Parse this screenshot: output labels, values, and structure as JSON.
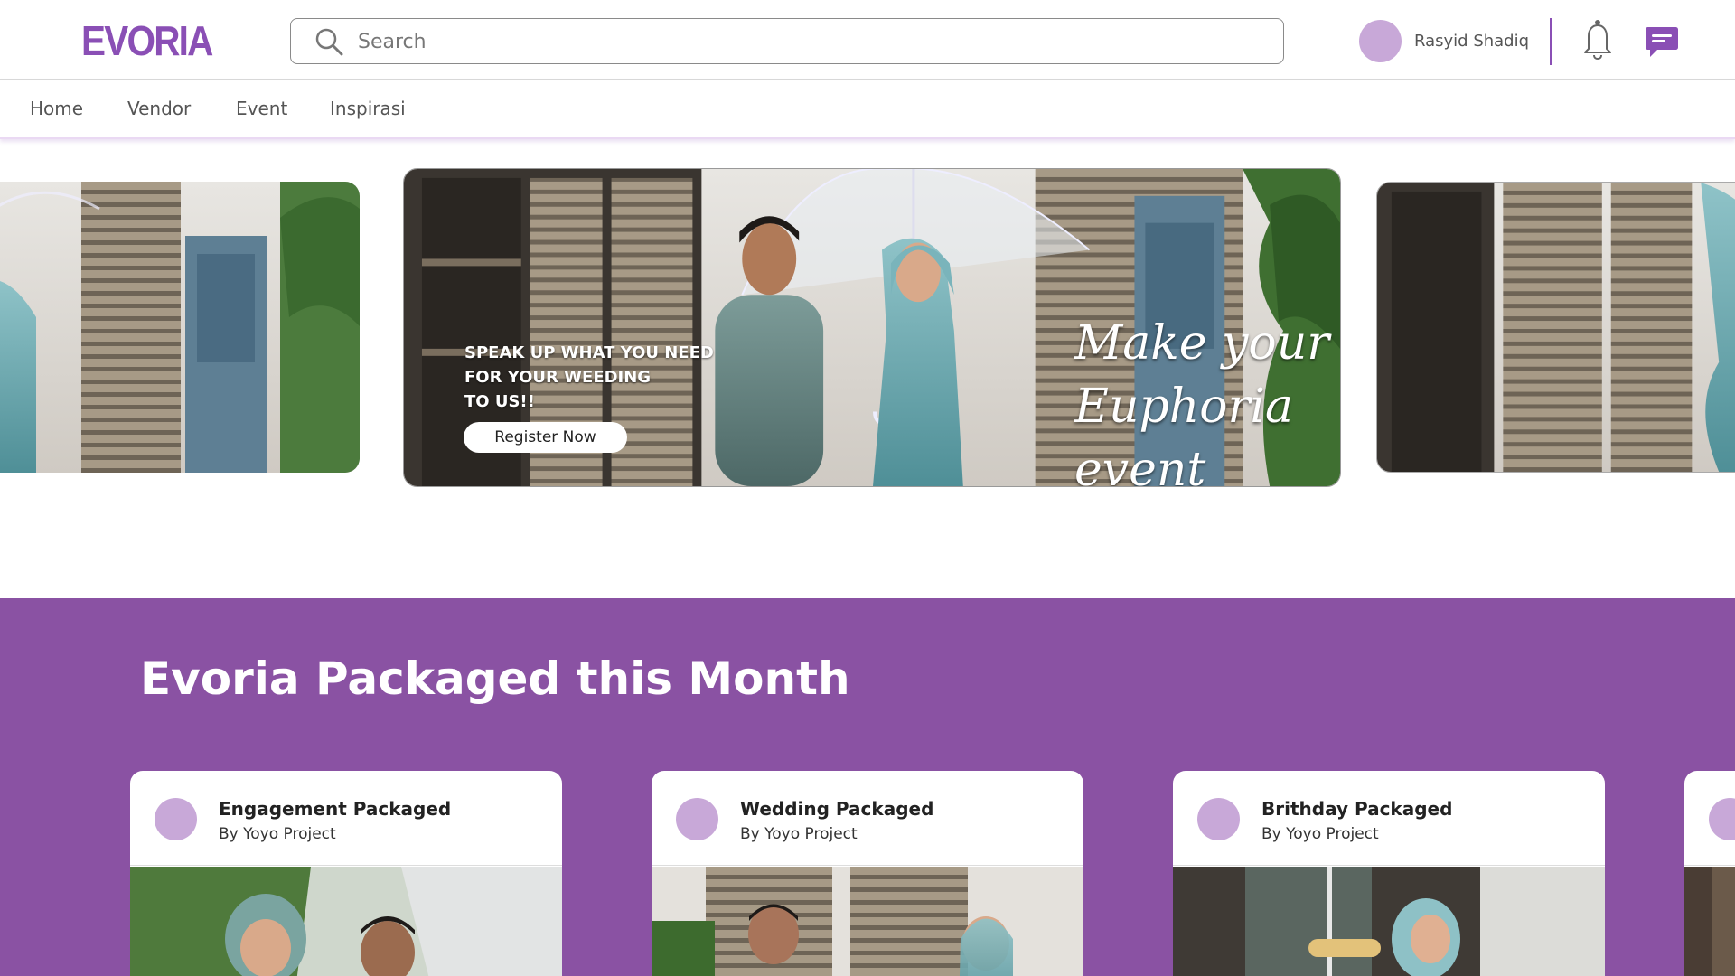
{
  "brand": {
    "logo": "EVORIA",
    "accent": "#8a4fb5",
    "section_bg": "#8a52a3",
    "avatar_color": "#c8a8d8"
  },
  "search": {
    "placeholder": "Search",
    "icon": "search-icon"
  },
  "user": {
    "name": "Rasyid Shadiq"
  },
  "icons": {
    "notifications": "bell-icon",
    "messages": "chat-icon"
  },
  "nav": {
    "items": [
      "Home",
      "Vendor",
      "Event",
      "Inspirasi"
    ]
  },
  "hero": {
    "promo_lines": [
      "SPEAK UP WHAT YOU NEED",
      "FOR YOUR WEEDING",
      "TO US!!"
    ],
    "cta_label": "Register Now",
    "tagline_lines": [
      "Make your",
      "Euphoria event"
    ]
  },
  "packages": {
    "title": "Evoria Packaged this Month",
    "cards": [
      {
        "title": "Engagement Packaged",
        "by": "By Yoyo Project"
      },
      {
        "title": "Wedding Packaged",
        "by": "By Yoyo Project"
      },
      {
        "title": "Brithday Packaged",
        "by": "By Yoyo Project"
      }
    ]
  }
}
